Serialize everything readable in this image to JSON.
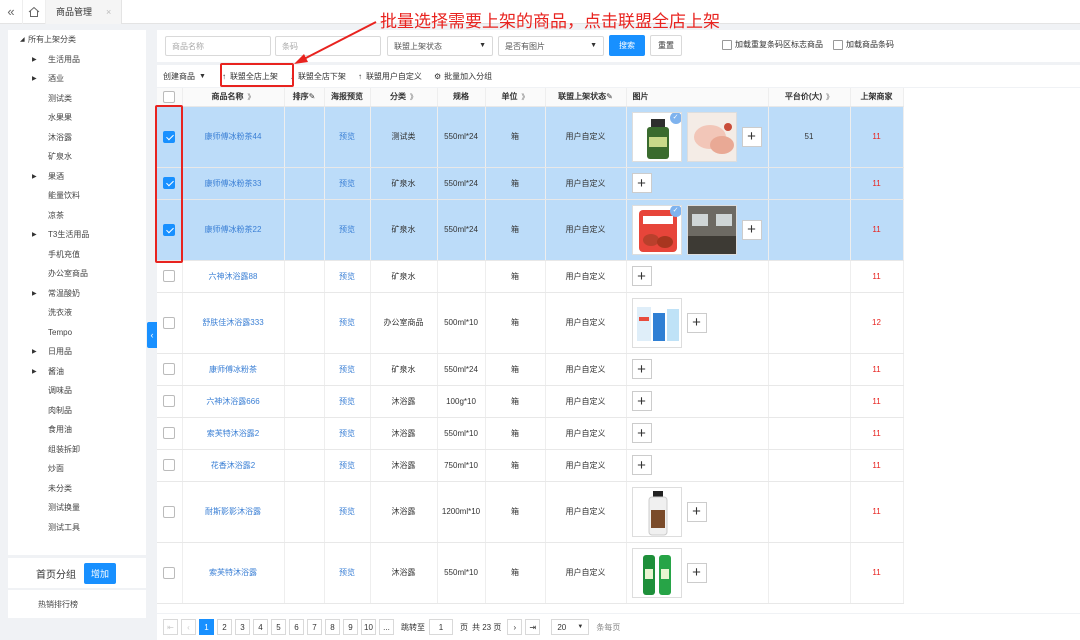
{
  "topbar": {
    "collapse": "«",
    "tab": "商品管理",
    "tab_close": "×"
  },
  "annotation": "批量选择需要上架的商品，点击联盟全店上架",
  "sidebar": {
    "root": "所有上架分类",
    "items": [
      {
        "label": "生活用品",
        "caret": true
      },
      {
        "label": "酒业",
        "caret": true
      },
      {
        "label": "测试类",
        "caret": false
      },
      {
        "label": "水果果",
        "caret": false
      },
      {
        "label": "沐浴露",
        "caret": false
      },
      {
        "label": "矿泉水",
        "caret": false
      },
      {
        "label": "果酒",
        "caret": true
      },
      {
        "label": "能量饮料",
        "caret": false
      },
      {
        "label": "凉茶",
        "caret": false
      },
      {
        "label": "T3生活用品",
        "caret": true
      },
      {
        "label": "手机充值",
        "caret": false
      },
      {
        "label": "办公室商品",
        "caret": false
      },
      {
        "label": "常温酸奶",
        "caret": true
      },
      {
        "label": "洗衣液",
        "caret": false
      },
      {
        "label": "Tempo",
        "caret": false
      },
      {
        "label": "日用品",
        "caret": true
      },
      {
        "label": "酱油",
        "caret": true
      },
      {
        "label": "调味品",
        "caret": false
      },
      {
        "label": "肉制品",
        "caret": false
      },
      {
        "label": "食用油",
        "caret": false
      },
      {
        "label": "组装拆卸",
        "caret": false
      },
      {
        "label": "炒面",
        "caret": false
      },
      {
        "label": "未分类",
        "caret": false
      },
      {
        "label": "测试换量",
        "caret": false
      },
      {
        "label": "测试工具",
        "caret": false
      }
    ],
    "group_label": "首页分组",
    "group_add": "增加",
    "bottom": "热销排行榜"
  },
  "filters": {
    "name_placeholder": "商品名称",
    "barcode_placeholder": "条码",
    "status_select": "联盟上架状态",
    "image_select": "是否有图片",
    "search": "搜索",
    "reset": "重置",
    "chk1": "加载重复条码区标志商品",
    "chk2": "加载商品条码"
  },
  "toolbar": {
    "create": "创建商品",
    "list_all": "联盟全店上架",
    "unlist_all": "联盟全店下架",
    "custom_list": "联盟用户自定义",
    "add_group": "批量加入分组"
  },
  "columns": [
    "商品名称",
    "排序",
    "海报预览",
    "分类",
    "规格",
    "单位",
    "联盟上架状态",
    "图片",
    "平台价(大)",
    "上架商家"
  ],
  "rows": [
    {
      "sel": true,
      "name": "康师傅冰粉茶44",
      "preview": "预览",
      "cat": "测试类",
      "spec": "550ml*24",
      "unit": "箱",
      "status": "用户自定义",
      "imgs": [
        "bottle",
        "food"
      ],
      "badge": true,
      "price": "51",
      "merch": "11",
      "h": 61
    },
    {
      "sel": true,
      "name": "康师傅冰粉茶33",
      "preview": "预览",
      "cat": "矿泉水",
      "spec": "550ml*24",
      "unit": "箱",
      "status": "用户自定义",
      "imgs": [],
      "badge": false,
      "price": "",
      "merch": "11",
      "h": 32
    },
    {
      "sel": true,
      "name": "康师傅冰粉茶22",
      "preview": "预览",
      "cat": "矿泉水",
      "spec": "550ml*24",
      "unit": "箱",
      "status": "用户自定义",
      "imgs": [
        "sausage",
        "office"
      ],
      "badge": true,
      "price": "",
      "merch": "11",
      "h": 61
    },
    {
      "sel": false,
      "name": "六神沐浴露88",
      "preview": "预览",
      "cat": "矿泉水",
      "spec": "",
      "unit": "箱",
      "status": "用户自定义",
      "imgs": [],
      "badge": false,
      "price": "",
      "merch": "11",
      "h": 32
    },
    {
      "sel": false,
      "name": "舒肤佳沐浴露333",
      "preview": "预览",
      "cat": "办公室商品",
      "spec": "500ml*10",
      "unit": "箱",
      "status": "用户自定义",
      "imgs": [
        "detergent"
      ],
      "badge": false,
      "price": "",
      "merch": "12",
      "h": 61
    },
    {
      "sel": false,
      "name": "康师傅冰粉茶",
      "preview": "预览",
      "cat": "矿泉水",
      "spec": "550ml*24",
      "unit": "箱",
      "status": "用户自定义",
      "imgs": [],
      "badge": false,
      "price": "",
      "merch": "11",
      "h": 32
    },
    {
      "sel": false,
      "name": "六神沐浴露666",
      "preview": "预览",
      "cat": "沐浴露",
      "spec": "100g*10",
      "unit": "箱",
      "status": "用户自定义",
      "imgs": [],
      "badge": false,
      "price": "",
      "merch": "11",
      "h": 32
    },
    {
      "sel": false,
      "name": "索芙特沐浴露2",
      "preview": "预览",
      "cat": "沐浴露",
      "spec": "550ml*10",
      "unit": "箱",
      "status": "用户自定义",
      "imgs": [],
      "badge": false,
      "price": "",
      "merch": "11",
      "h": 32
    },
    {
      "sel": false,
      "name": "花香沐浴露2",
      "preview": "预览",
      "cat": "沐浴露",
      "spec": "750ml*10",
      "unit": "箱",
      "status": "用户自定义",
      "imgs": [],
      "badge": false,
      "price": "",
      "merch": "11",
      "h": 32
    },
    {
      "sel": false,
      "name": "耐斯影影沐浴露",
      "preview": "预览",
      "cat": "沐浴露",
      "spec": "1200ml*10",
      "unit": "箱",
      "status": "用户自定义",
      "imgs": [
        "shampoo"
      ],
      "badge": false,
      "price": "",
      "merch": "11",
      "h": 61
    },
    {
      "sel": false,
      "name": "索芙特沐浴露",
      "preview": "预览",
      "cat": "沐浴露",
      "spec": "550ml*10",
      "unit": "箱",
      "status": "用户自定义",
      "imgs": [
        "green_bottles"
      ],
      "badge": false,
      "price": "",
      "merch": "11",
      "h": 61
    }
  ],
  "pager": {
    "pages": [
      "1",
      "2",
      "3",
      "4",
      "5",
      "6",
      "7",
      "8",
      "9",
      "10",
      "..."
    ],
    "goto": "跳转至",
    "goto_val": "1",
    "page_unit": "页",
    "total": "共 23 页",
    "size": "20",
    "per_page": "条每页"
  },
  "colors": {
    "accent": "#1890ff",
    "selected_row": "#bcdcf9",
    "annotation": "#e8231f"
  }
}
